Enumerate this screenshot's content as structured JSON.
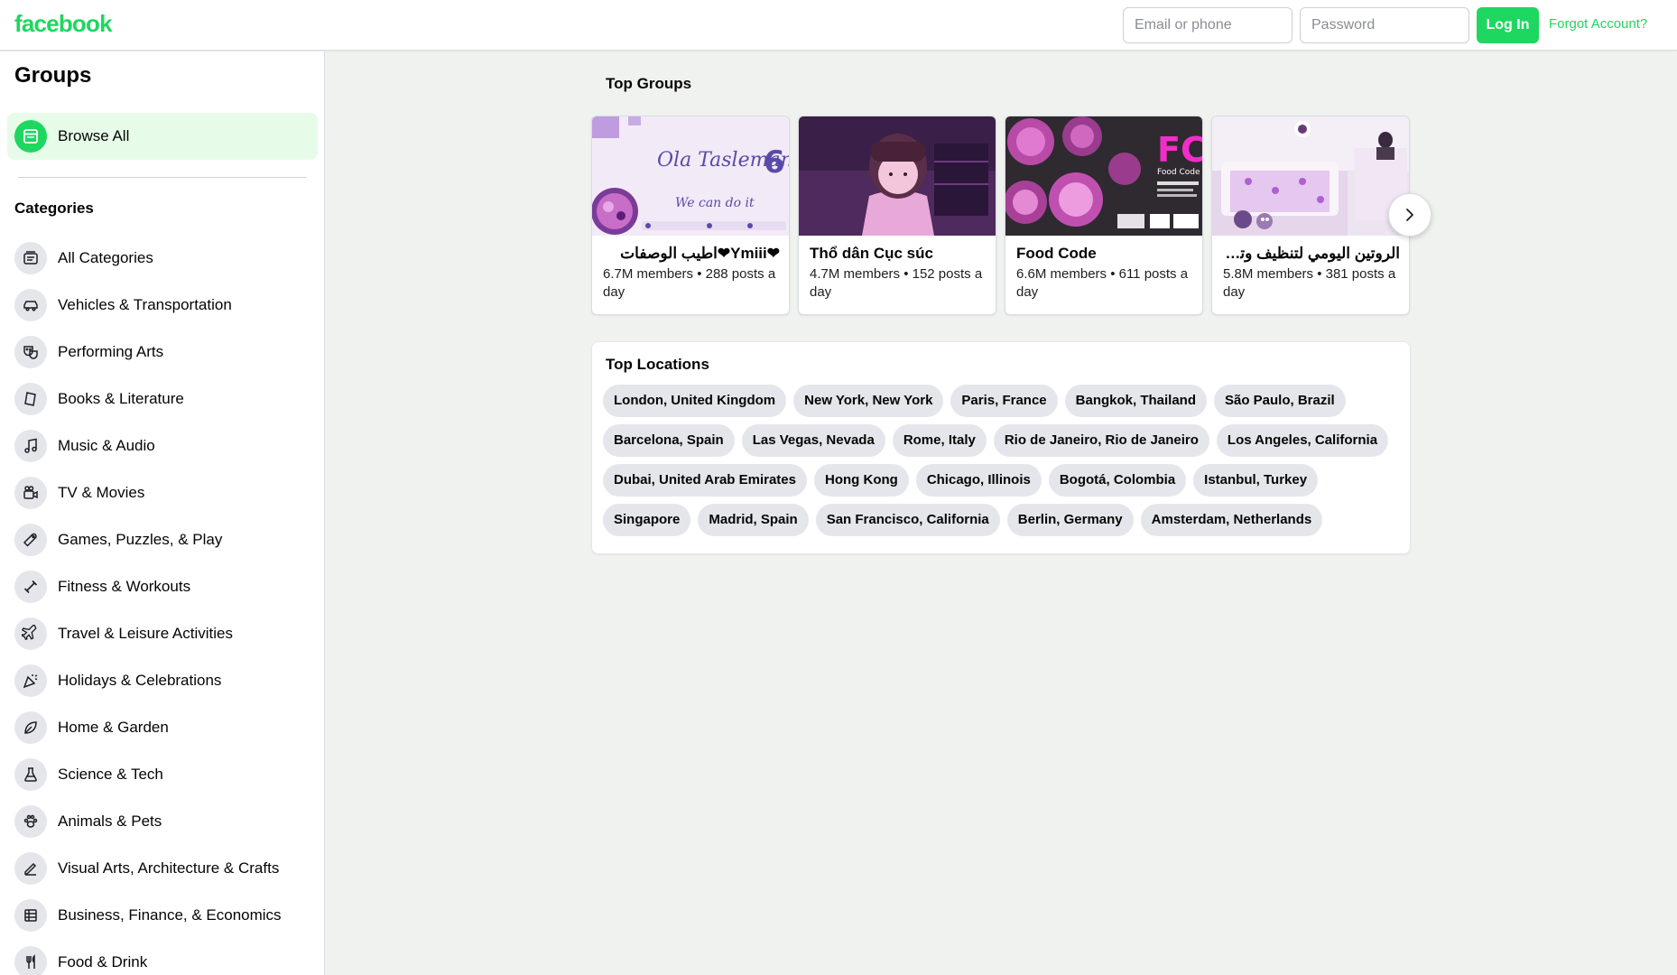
{
  "header": {
    "logo": "facebook",
    "email_placeholder": "Email or phone",
    "password_placeholder": "Password",
    "login_label": "Log In",
    "forgot_label": "Forgot Account?",
    "accent_color": "#1ed760"
  },
  "sidebar": {
    "title": "Groups",
    "browse_all": {
      "label": "Browse All",
      "icon": "browse-icon"
    },
    "categories_heading": "Categories",
    "categories": [
      {
        "label": "All Categories",
        "icon": "categories-icon"
      },
      {
        "label": "Vehicles & Transportation",
        "icon": "car-icon"
      },
      {
        "label": "Performing Arts",
        "icon": "masks-icon"
      },
      {
        "label": "Books & Literature",
        "icon": "book-icon"
      },
      {
        "label": "Music & Audio",
        "icon": "music-note-icon"
      },
      {
        "label": "TV & Movies",
        "icon": "video-camera-icon"
      },
      {
        "label": "Games, Puzzles, & Play",
        "icon": "game-controller-icon"
      },
      {
        "label": "Fitness & Workouts",
        "icon": "dumbbell-icon"
      },
      {
        "label": "Travel & Leisure Activities",
        "icon": "airplane-icon"
      },
      {
        "label": "Holidays & Celebrations",
        "icon": "party-popper-icon"
      },
      {
        "label": "Home & Garden",
        "icon": "leaf-icon"
      },
      {
        "label": "Science & Tech",
        "icon": "flask-icon"
      },
      {
        "label": "Animals & Pets",
        "icon": "paw-icon"
      },
      {
        "label": "Visual Arts, Architecture & Crafts",
        "icon": "pen-icon"
      },
      {
        "label": "Business, Finance, & Economics",
        "icon": "ledger-icon"
      },
      {
        "label": "Food & Drink",
        "icon": "fork-knife-icon"
      }
    ]
  },
  "top_groups": {
    "title": "Top Groups",
    "groups": [
      {
        "name": "❤Ymiii❤اطيب الوصفات",
        "meta": "6.7M members • 288 posts a day"
      },
      {
        "name": "Thổ dân Cục súc",
        "meta": "4.7M members • 152 posts a day"
      },
      {
        "name": "Food Code",
        "meta": "6.6M members • 611 posts a day"
      },
      {
        "name": "الروتين اليومي لتنظيف وترتيب المنزل",
        "meta": "5.8M members • 381 posts a day"
      }
    ],
    "image_text": {
      "g1_title": "Ola Tasleman",
      "g1_badge": "6",
      "g1_slogan": "We can do it",
      "g3_logo": "FC",
      "g3_label": "Food Code"
    },
    "next_icon": "chevron-right-icon"
  },
  "top_locations": {
    "title": "Top Locations",
    "locations": [
      "London, United Kingdom",
      "New York, New York",
      "Paris, France",
      "Bangkok, Thailand",
      "São Paulo, Brazil",
      "Barcelona, Spain",
      "Las Vegas, Nevada",
      "Rome, Italy",
      "Rio de Janeiro, Rio de Janeiro",
      "Los Angeles, California",
      "Dubai, United Arab Emirates",
      "Hong Kong",
      "Chicago, Illinois",
      "Bogotá, Colombia",
      "Istanbul, Turkey",
      "Singapore",
      "Madrid, Spain",
      "San Francisco, California",
      "Berlin, Germany",
      "Amsterdam, Netherlands"
    ]
  }
}
